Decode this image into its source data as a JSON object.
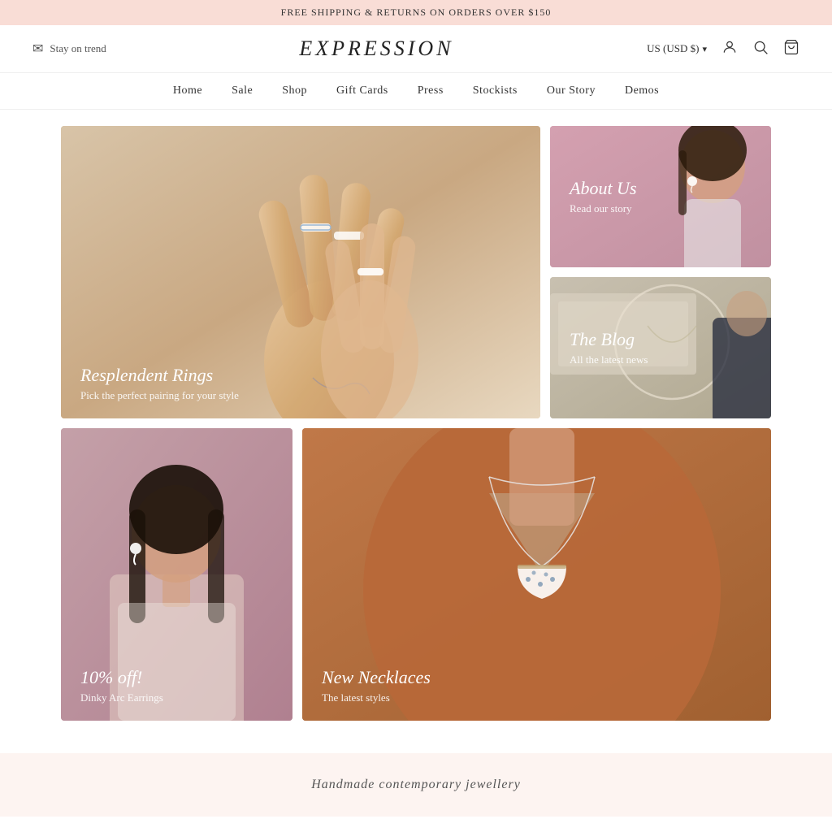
{
  "announcement": {
    "text": "FREE SHIPPING & RETURNS ON ORDERS OVER $150"
  },
  "header": {
    "newsletter_icon": "envelope-icon",
    "newsletter_label": "Stay on trend",
    "logo": "EXPRESSION",
    "currency": "US (USD $)",
    "icons": {
      "user": "user-icon",
      "search": "search-icon",
      "bag": "bag-icon"
    }
  },
  "nav": {
    "items": [
      {
        "label": "Home",
        "href": "#"
      },
      {
        "label": "Sale",
        "href": "#"
      },
      {
        "label": "Shop",
        "href": "#"
      },
      {
        "label": "Gift Cards",
        "href": "#"
      },
      {
        "label": "Press",
        "href": "#"
      },
      {
        "label": "Stockists",
        "href": "#"
      },
      {
        "label": "Our Story",
        "href": "#"
      },
      {
        "label": "Demos",
        "href": "#"
      }
    ]
  },
  "grid": {
    "card_rings": {
      "title": "Resplendent Rings",
      "subtitle": "Pick the perfect pairing for your style"
    },
    "card_about": {
      "title": "About Us",
      "subtitle": "Read our story"
    },
    "card_blog": {
      "title": "The Blog",
      "subtitle": "All the latest news"
    },
    "card_earrings": {
      "badge": "10% off!",
      "title": "Dinky Arc Earrings"
    },
    "card_necklaces": {
      "title": "New Necklaces",
      "subtitle": "The latest styles"
    }
  },
  "footer": {
    "tagline": "Handmade contemporary jewellery"
  }
}
